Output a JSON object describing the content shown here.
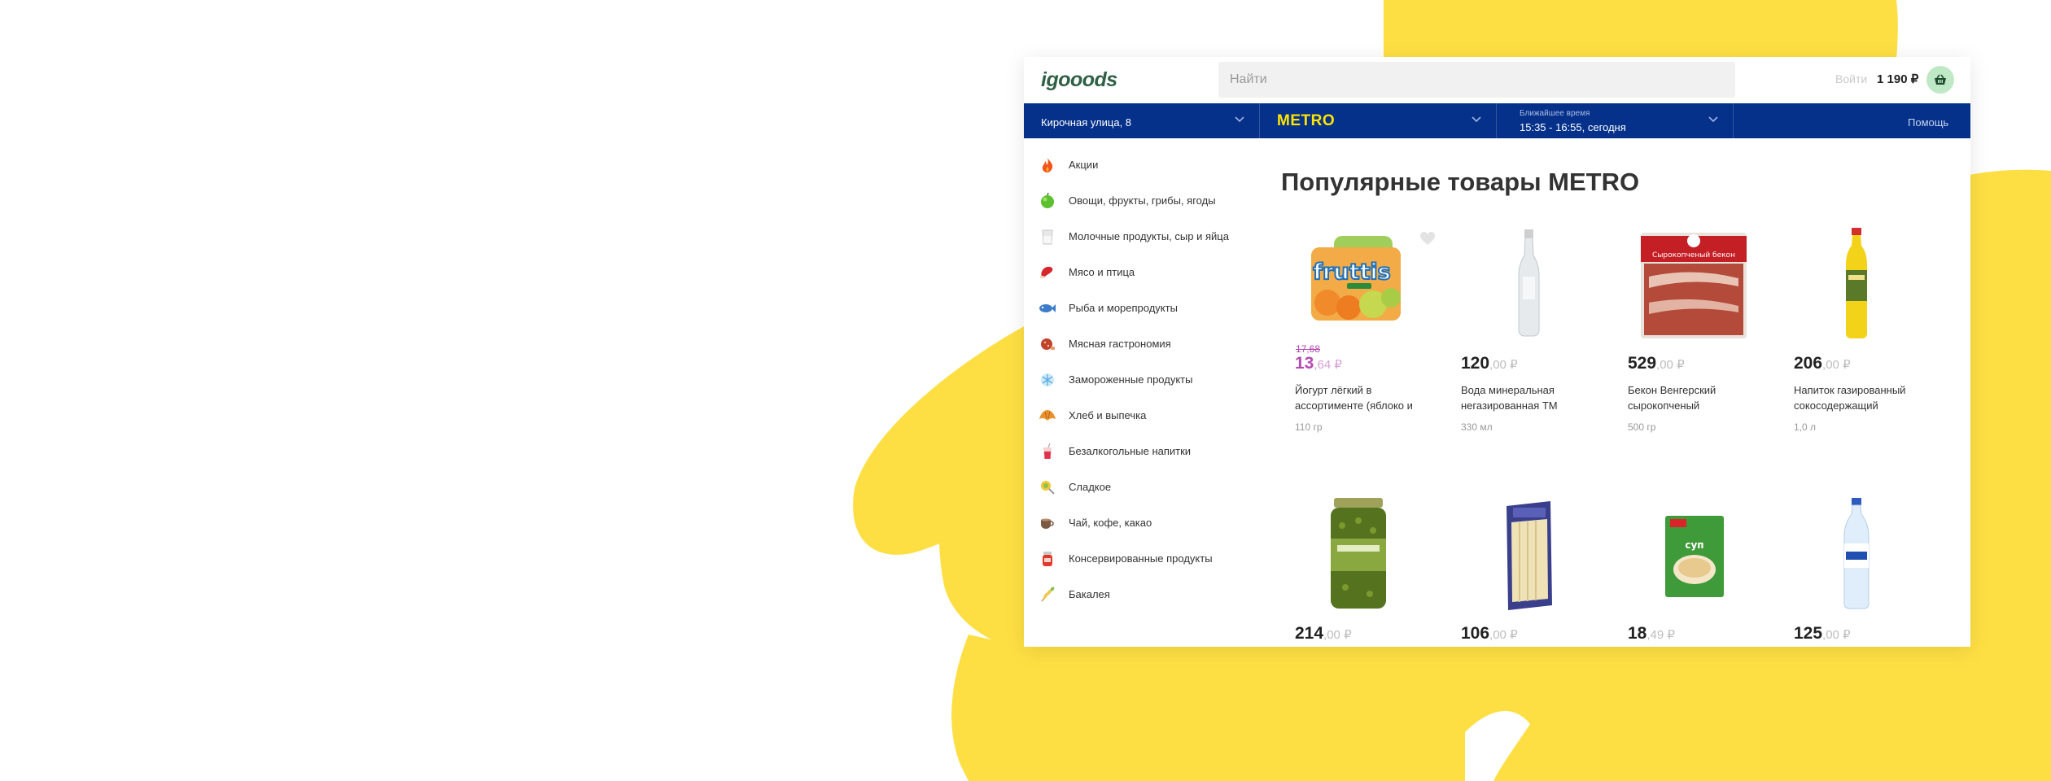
{
  "colors": {
    "accent_yellow": "#fedf43",
    "nav_blue": "#05318a",
    "metro_yellow": "#ffe500",
    "promo_purple": "#b34bb0",
    "cart_green": "#bfe9c6",
    "logo_green": "#2f6045"
  },
  "header": {
    "logo": "igooods",
    "search_placeholder": "Найти",
    "login_label": "Войти",
    "cart_total": "1 190 ₽",
    "cart_icon": "basket-icon"
  },
  "navbar": {
    "address": "Кирочная улица, 8",
    "store": "METRO",
    "delivery_caption": "Ближайшее время",
    "delivery_time": "15:35 - 16:55, сегодня",
    "help": "Помощь"
  },
  "sidebar": {
    "items": [
      {
        "label": "Акции",
        "icon": "fire-icon"
      },
      {
        "label": "Овощи, фрукты, грибы, ягоды",
        "icon": "apple-icon"
      },
      {
        "label": "Молочные продукты, сыр и яйца",
        "icon": "milk-icon"
      },
      {
        "label": "Мясо и птица",
        "icon": "meat-icon"
      },
      {
        "label": "Рыба и морепродукты",
        "icon": "fish-icon"
      },
      {
        "label": "Мясная гастрономия",
        "icon": "sausage-icon"
      },
      {
        "label": "Замороженные продукты",
        "icon": "snowflake-icon"
      },
      {
        "label": "Хлеб и выпечка",
        "icon": "croissant-icon"
      },
      {
        "label": "Безалкогольные напитки",
        "icon": "drink-icon"
      },
      {
        "label": "Сладкое",
        "icon": "lollipop-icon"
      },
      {
        "label": "Чай, кофе, какао",
        "icon": "coffee-icon"
      },
      {
        "label": "Консервированные продукты",
        "icon": "jar-icon"
      },
      {
        "label": "Бакалея",
        "icon": "wheat-icon"
      }
    ]
  },
  "main": {
    "title": "Популярные товары METRO",
    "products": [
      {
        "old_price": "17,68",
        "price_int": "13",
        "price_cents": ",64 ₽",
        "promo": true,
        "name": "Йогурт лёгкий в ассортименте (яблоко и",
        "weight": "110 гр",
        "image": "yogurt-pack-image",
        "favorite_icon": "heart-icon"
      },
      {
        "old_price": "",
        "price_int": "120",
        "price_cents": ",00 ₽",
        "promo": false,
        "name": "Вода минеральная негазированная ТМ",
        "weight": "330 мл",
        "image": "glass-bottle-image"
      },
      {
        "old_price": "",
        "price_int": "529",
        "price_cents": ",00 ₽",
        "promo": false,
        "name": "Бекон Венгерский сырокопченый",
        "weight": "500 гр",
        "image": "bacon-pack-image"
      },
      {
        "old_price": "",
        "price_int": "206",
        "price_cents": ",00 ₽",
        "promo": false,
        "name": "Напиток газированный сокосодержащий",
        "weight": "1,0 л",
        "image": "juice-bottle-image"
      },
      {
        "old_price": "",
        "price_int": "214",
        "price_cents": ",00 ₽",
        "promo": false,
        "name": "",
        "weight": "",
        "image": "peas-jar-image"
      },
      {
        "old_price": "",
        "price_int": "106",
        "price_cents": ",00 ₽",
        "promo": false,
        "name": "",
        "weight": "",
        "image": "pasta-pack-image"
      },
      {
        "old_price": "",
        "price_int": "18",
        "price_cents": ",49 ₽",
        "promo": false,
        "name": "",
        "weight": "",
        "image": "soup-pack-image"
      },
      {
        "old_price": "",
        "price_int": "125",
        "price_cents": ",00 ₽",
        "promo": false,
        "name": "",
        "weight": "",
        "image": "water-bottle-image"
      }
    ]
  }
}
